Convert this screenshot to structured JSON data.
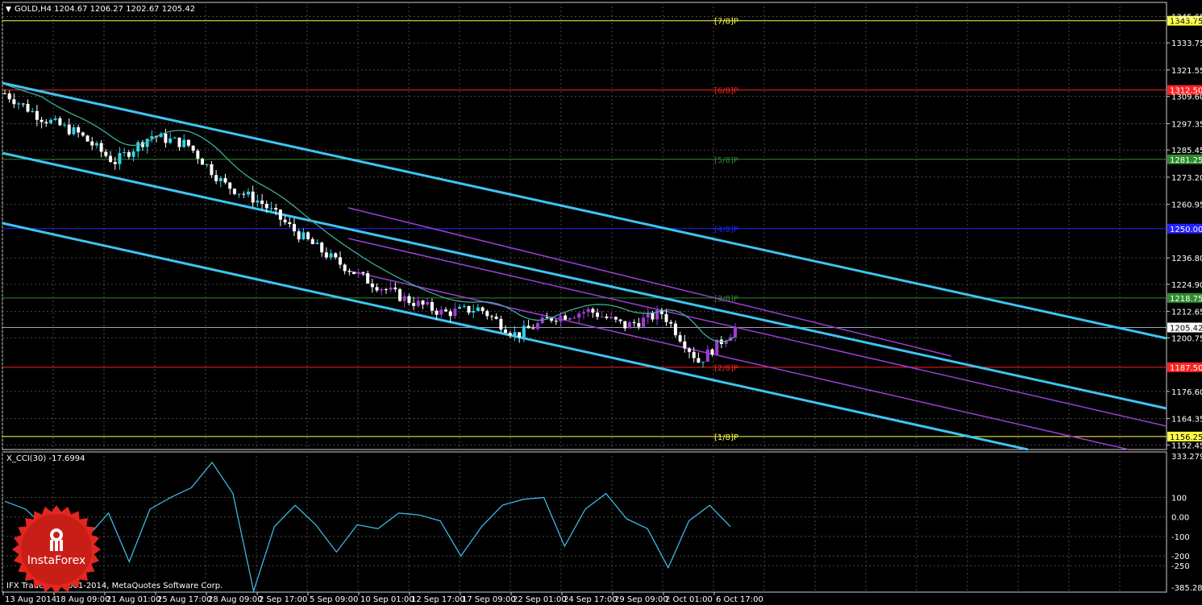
{
  "main_panel": {
    "title_arrow": "▼",
    "title": "GOLD,H4  1204.67 1206.27 1202.67 1205.42"
  },
  "indicator_panel": {
    "title": "X_CCI(30) -17.6994",
    "top_value": "333.2797",
    "bottom_value": "-385.2823",
    "ticks": [
      "100",
      "0.00",
      "-100",
      "-200",
      "-250"
    ]
  },
  "price_ticks": [
    "1345.65",
    "1333.75",
    "1321.55",
    "1309.60",
    "1297.35",
    "1285.45",
    "1273.20",
    "1260.95",
    "1236.80",
    "1224.90",
    "1212.65",
    "1200.75",
    "1176.60",
    "1164.35",
    "1152.45"
  ],
  "time_ticks": [
    "13 Aug 2014",
    "18 Aug 09:00",
    "21 Aug 01:00",
    "25 Aug 17:00",
    "28 Aug 09:00",
    "2 Sep 17:00",
    "5 Sep 09:00",
    "10 Sep 01:00",
    "12 Sep 17:00",
    "17 Sep 09:00",
    "22 Sep 01:00",
    "24 Sep 17:00",
    "29 Sep 09:00",
    "2 Oct 01:00",
    "6 Oct 17:00"
  ],
  "murrey_levels": [
    {
      "label": "[7/8]P",
      "price": "1343.75",
      "price_value": 1343.75,
      "color": "#ffff44"
    },
    {
      "label": "[6/8]P",
      "price": "1312.50",
      "price_value": 1312.5,
      "color": "#ff2222"
    },
    {
      "label": "[5/8]P",
      "price": "1281.25",
      "price_value": 1281.25,
      "color": "#2e8b2e"
    },
    {
      "label": "[4/8]P",
      "price": "1250.00",
      "price_value": 1250.0,
      "color": "#2222ff"
    },
    {
      "label": "[3/8]P",
      "price": "1218.75",
      "price_value": 1218.75,
      "color": "#2e8b2e"
    },
    {
      "label": "[2/8]P",
      "price": "1187.50",
      "price_value": 1187.5,
      "color": "#ff2222"
    },
    {
      "label": "[1/8]P",
      "price": "1156.25",
      "price_value": 1156.25,
      "color": "#ffff44"
    }
  ],
  "current_price": {
    "label": "1205.42",
    "value": 1205.42
  },
  "footer": "IFX Trader, © 2001-2014, MetaQuotes Software Corp.",
  "logo": {
    "text": "InstaForex",
    "color": "#e3261f"
  },
  "chart_data": {
    "type": "candlestick",
    "symbol": "GOLD",
    "timeframe": "H4",
    "ohlc_last": {
      "open": 1204.67,
      "high": 1206.27,
      "low": 1202.67,
      "close": 1205.42
    },
    "x_dates": [
      "13 Aug 2014",
      "18 Aug 09:00",
      "21 Aug 01:00",
      "25 Aug 17:00",
      "28 Aug 09:00",
      "2 Sep 17:00",
      "5 Sep 09:00",
      "10 Sep 01:00",
      "12 Sep 17:00",
      "17 Sep 09:00",
      "22 Sep 01:00",
      "24 Sep 17:00",
      "29 Sep 09:00",
      "2 Oct 01:00",
      "6 Oct 17:00"
    ],
    "close_approx": [
      1311,
      1300,
      1293,
      1280,
      1292,
      1288,
      1270,
      1262,
      1248,
      1236,
      1226,
      1218,
      1212,
      1214,
      1202,
      1210,
      1213,
      1206,
      1212,
      1190,
      1205
    ],
    "ylim": [
      1150.4,
      1352.0
    ],
    "cci": {
      "period": 30,
      "last": -17.6994,
      "values": [
        80,
        40,
        -60,
        -200,
        -100,
        20,
        -230,
        40,
        100,
        150,
        280,
        120,
        -380,
        -50,
        60,
        -40,
        -180,
        -40,
        -60,
        20,
        10,
        -20,
        -200,
        -50,
        60,
        90,
        100,
        -150,
        40,
        120,
        -10,
        -60,
        -260,
        -20,
        60,
        -50
      ],
      "ylim": [
        -385.2823,
        333.2797
      ]
    },
    "grid": true
  }
}
